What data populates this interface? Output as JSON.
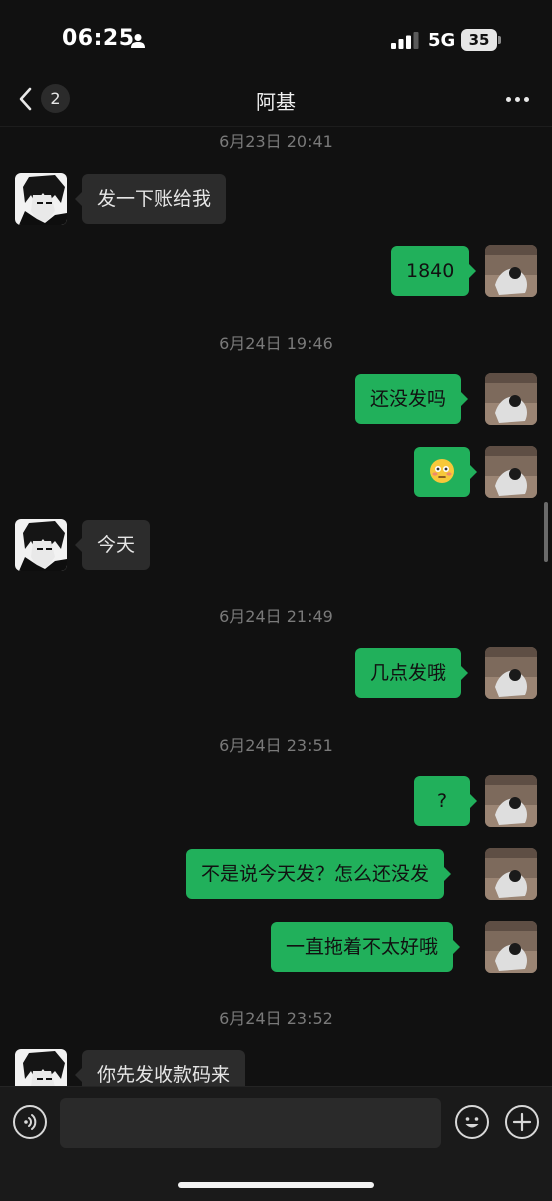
{
  "status_bar": {
    "time": "06:25",
    "network": "5G",
    "battery": "35"
  },
  "nav": {
    "title": "阿基",
    "unread_count": "2"
  },
  "messages": {
    "ts1": "6月23日 20:41",
    "m1": "发一下账给我",
    "m2": "1840",
    "ts2": "6月24日 19:46",
    "m3": "还没发吗",
    "m4_emoji": "flushed-face-emoji",
    "m5": "今天",
    "ts3": "6月24日 21:49",
    "m6": "几点发哦",
    "ts4": "6月24日 23:51",
    "m7": "?",
    "m8": "不是说今天发？怎么还没发",
    "m9": "一直拖着不太好哦",
    "ts5": "6月24日 23:52",
    "m10": "你先发收款码来"
  },
  "input_bar": {
    "value": ""
  },
  "colors": {
    "accent": "#21b05b",
    "incoming_bubble": "#2c2c2c",
    "background": "#111111"
  }
}
